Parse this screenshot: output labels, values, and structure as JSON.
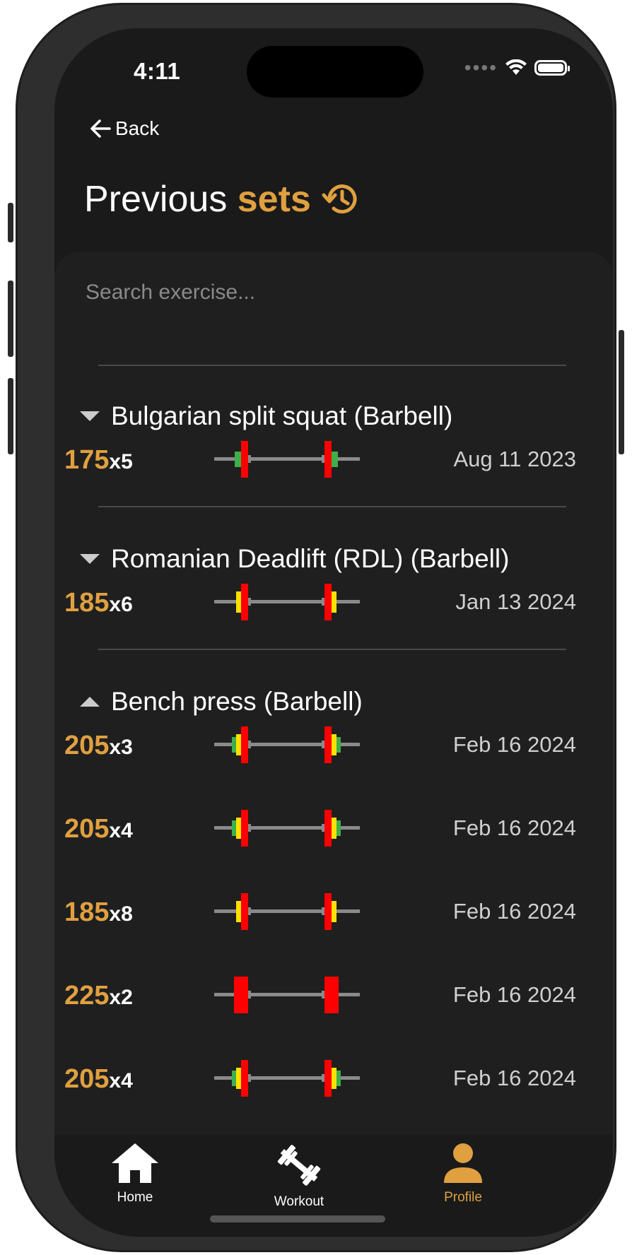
{
  "status": {
    "time": "4:11"
  },
  "nav": {
    "back_label": "Back"
  },
  "title": {
    "prefix": "Previous",
    "accent": "sets"
  },
  "search": {
    "placeholder": "Search exercise..."
  },
  "colors": {
    "accent": "#e0a040",
    "plate_red": "#ff0000",
    "plate_yellow": "#ffe000",
    "plate_green": "#3cb04a",
    "bar": "#8a8a8a"
  },
  "exercises": [
    {
      "name": "Bulgarian split squat (Barbell)",
      "expanded": false,
      "sets": [
        {
          "weight": "175",
          "reps": "x5",
          "date": "Aug 11 2023"
        }
      ]
    },
    {
      "name": "Romanian Deadlift (RDL) (Barbell)",
      "expanded": false,
      "sets": [
        {
          "weight": "185",
          "reps": "x6",
          "date": "Jan 13 2024"
        }
      ]
    },
    {
      "name": "Bench press (Barbell)",
      "expanded": true,
      "sets": [
        {
          "weight": "205",
          "reps": "x3",
          "date": "Feb 16 2024"
        },
        {
          "weight": "205",
          "reps": "x4",
          "date": "Feb 16 2024"
        },
        {
          "weight": "185",
          "reps": "x8",
          "date": "Feb 16 2024"
        },
        {
          "weight": "225",
          "reps": "x2",
          "date": "Feb 16 2024"
        },
        {
          "weight": "205",
          "reps": "x4",
          "date": "Feb 16 2024"
        }
      ]
    }
  ],
  "tabs": [
    {
      "label": "Home",
      "icon": "home-icon"
    },
    {
      "label": "Workout",
      "icon": "dumbbell-icon"
    },
    {
      "label": "Profile",
      "icon": "person-icon",
      "active": true
    }
  ]
}
